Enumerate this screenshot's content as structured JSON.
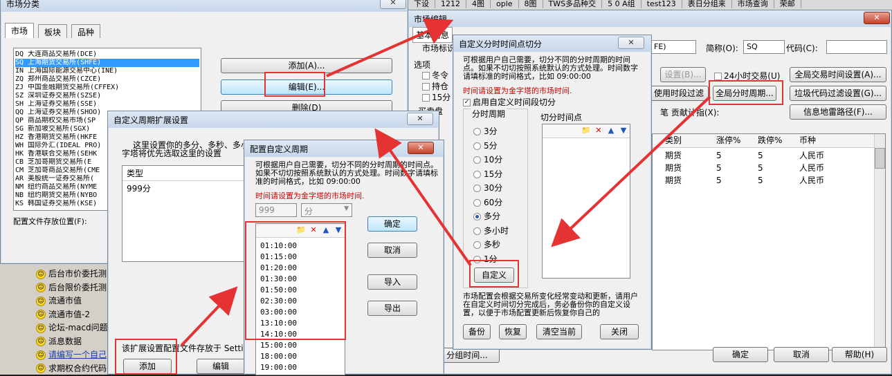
{
  "market_window": {
    "title": "市场分类",
    "tabs": [
      "市场",
      "板块",
      "品种"
    ],
    "markets": [
      "DQ 大连商品交易所(DCE)",
      "SQ 上海期货交易所(SHFE)",
      "IN 上海国际能源交易中心(INE)",
      "ZQ 郑州商品交易所(CZCE)",
      "ZJ 中国金融期货交易所(CFFEX)",
      "SZ 深圳证券交易所(SZSE)",
      "SH 上海证券交易所(SSE)",
      "QQ 上海证券交易所(SHOO)",
      "QP 商品期权交易市场(SP",
      "SG 新加坡交易所(SGX)",
      "HZ 香港期货交易所(HKFE",
      "WH 国际外汇(IDEAL PRO)",
      "HK 香港联合交易所(SEHK",
      "CB 芝加哥期货交易所(E",
      "CM 芝加哥商品交易所(CME",
      "AR 美股统一证券交易所(",
      "NM 纽约商品交易所(NYME",
      "NB 纽约期货交易所(NYBO",
      "KS 韩国证券交易所(KSE)"
    ],
    "add_btn": "添加(A)...",
    "edit_btn": "编辑(E)...",
    "delete_btn": "删除(D)",
    "config_label": "配置文件存放位置(F):"
  },
  "top_tabs": [
    "下设",
    "1212",
    "4图",
    "ople",
    "8图",
    "TWS多品种交",
    "5 0 A组",
    "test123",
    "表日分组来",
    "市场查询",
    "荣邮"
  ],
  "sidebar_items": [
    "后台市价委托测",
    "后台限价委托测",
    "流通市值",
    "流通市值-2",
    "论坛-macd问题",
    "派息数据",
    "请编写一个自己",
    "求期权合约代码"
  ],
  "market_edit": {
    "title": "市场编辑",
    "basic_info": "基本信息",
    "market_label_label": "市场标识",
    "market_id_value": "FE)",
    "short_name_label": "简称(O):",
    "short_name_value": "SQ",
    "code_label": "代码(C):",
    "options_label": "选项",
    "opt_items": [
      "冬令",
      "持仓",
      "15分"
    ],
    "buy_label": "买卖盘",
    "settings_btn": "设置(B)...",
    "h24_label": "24小时交易(U)",
    "global_time_btn": "全局交易时间设置(A)...",
    "use_time_filter_btn": "使用时段过滤",
    "global_period_btn": "全局分时周期...",
    "junk_filter_btn": "垃圾代码过滤设置(G)...",
    "contribution_label": "笔 贡献计指(X):",
    "info_mine_btn": "信息地雷路径(F)...",
    "columns": [
      "类别",
      "涨停%",
      "跌停%",
      "币种"
    ],
    "rows": [
      [
        "期货",
        "5",
        "5",
        "人民币"
      ],
      [
        "期货",
        "5",
        "5",
        "人民币"
      ],
      [
        "期货",
        "5",
        "5",
        "人民币"
      ]
    ],
    "split_time_btn": "分组时间...",
    "ok_btn": "确定",
    "cancel_btn": "取消",
    "help_btn": "帮助(H)"
  },
  "split_dialog": {
    "title": "自定义分时时间点切分",
    "desc": "可根据用户自己需要，切分不同的分时周期的时间点。如果不切切按照系统默认的方式处理。时间数字请填标准的时间格式，比如 09:00:00",
    "red_note": "时间请设置为金字塔的市场时间.",
    "enable_label": "启用自定义时间段切分",
    "period_group": "分时周期",
    "periods": [
      "3分",
      "5分",
      "10分",
      "15分",
      "30分",
      "60分",
      "多分",
      "多小时",
      "多秒",
      "1分"
    ],
    "selected_period": "多分",
    "split_group": "切分时间点",
    "custom_btn": "自定义",
    "footer_text": "市场配置会根据交易所变化经常变动和更新，请用户在自定义时间切分完成后，务必备份你的自定义设置，以便于市场配置更新后恢复你自己的",
    "backup_btn": "备份",
    "restore_btn": "恢复",
    "clear_btn": "清空当前",
    "close_btn": "关闭"
  },
  "ext_dialog": {
    "title": "自定义周期扩展设置",
    "desc": "这里设置你的多分、多秒、多小",
    "desc2": "字塔将优先选取这里的设置",
    "type_header": "类型",
    "type_value": "999分",
    "footer_text": "该扩展设置配置文件存放于 Setti",
    "add_btn": "添加",
    "edit_btn": "编辑"
  },
  "config_dialog": {
    "title": "配置自定义周期",
    "desc": "可根据用户自己需要，切分不同的分时周期的时间点。如果不切切按照系统默认的方式处理。时间数字请填标准的时间格式，比如 09:00:00",
    "red_note": "时间请设置为金字塔的市场时间.",
    "number_value": "999",
    "unit_value": "分",
    "times": [
      "01:10:00",
      "01:15:00",
      "01:20:00",
      "01:30:00",
      "01:50:00",
      "02:30:00",
      "03:00:00",
      "13:10:00",
      "14:10:00",
      "15:00:00",
      "18:00:00",
      "19:00:00"
    ],
    "ok_btn": "确定",
    "cancel_btn": "取消",
    "import_btn": "导入",
    "export_btn": "导出"
  },
  "colors": {
    "highlight": "#3399ff",
    "red_box": "#e53232",
    "red_text": "#d00000"
  }
}
